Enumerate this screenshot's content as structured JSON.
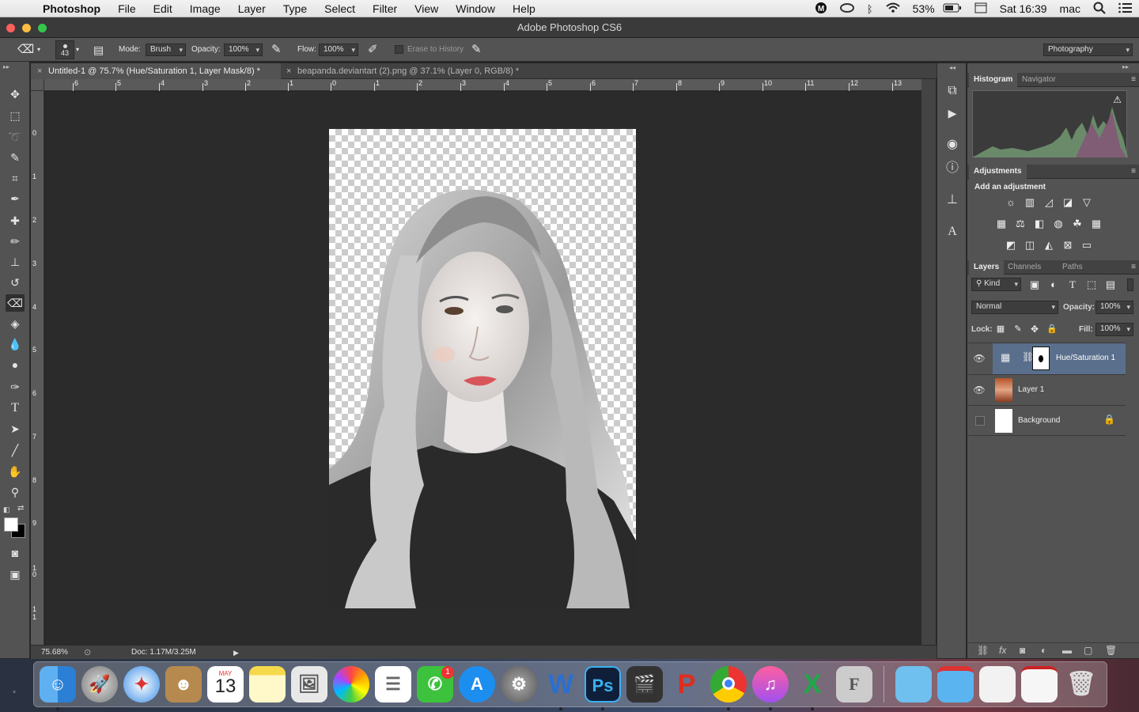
{
  "menubar": {
    "app_name": "Photoshop",
    "items": [
      "File",
      "Edit",
      "Image",
      "Layer",
      "Type",
      "Select",
      "Filter",
      "View",
      "Window",
      "Help"
    ],
    "battery": "53%",
    "clock": "Sat 16:39",
    "user": "mac"
  },
  "window": {
    "title": "Adobe Photoshop CS6"
  },
  "options": {
    "brush_size": "43",
    "mode_label": "Mode:",
    "mode_value": "Brush",
    "opacity_label": "Opacity:",
    "opacity_value": "100%",
    "flow_label": "Flow:",
    "flow_value": "100%",
    "erase_history": "Erase to History",
    "workspace": "Photography"
  },
  "tabs": [
    {
      "label": "Untitled-1 @ 75.7% (Hue/Saturation 1, Layer Mask/8) *"
    },
    {
      "label": "beapanda.deviantart (2).png @ 37.1% (Layer 0, RGB/8) *"
    }
  ],
  "ruler": {
    "h": [
      "6",
      "5",
      "4",
      "3",
      "2",
      "1",
      "0",
      "1",
      "2",
      "3",
      "4",
      "5",
      "6",
      "7",
      "8",
      "9",
      "10",
      "11",
      "12",
      "13"
    ],
    "v": [
      "0",
      "1",
      "2",
      "3",
      "4",
      "5",
      "6",
      "7",
      "8",
      "9",
      "1",
      "0",
      "1",
      "1"
    ]
  },
  "status": {
    "zoom": "75.68%",
    "doc": "Doc: 1.17M/3.25M"
  },
  "panels": {
    "histogram_tabs": [
      "Histogram",
      "Navigator"
    ],
    "adjustments_tab": "Adjustments",
    "adjustments_title": "Add an adjustment",
    "layers_tabs": [
      "Layers",
      "Channels",
      "Paths"
    ],
    "kind": "Kind",
    "blend_mode": "Normal",
    "opacity_label": "Opacity:",
    "opacity_value": "100%",
    "lock_label": "Lock:",
    "fill_label": "Fill:",
    "fill_value": "100%",
    "layers": [
      {
        "name": "Hue/Saturation 1"
      },
      {
        "name": "Layer 1"
      },
      {
        "name": "Background"
      }
    ]
  },
  "dock": {
    "calendar_month": "MAY",
    "calendar_day": "13",
    "facetime_badge": "1",
    "apps": [
      "finder",
      "launchpad",
      "safari",
      "contacts",
      "calendar",
      "notes",
      "preview",
      "photos",
      "reminders",
      "facetime",
      "app-store",
      "system-preferences",
      "word",
      "photoshop",
      "final-cut",
      "powerpoint",
      "chrome",
      "itunes",
      "excel",
      "font-book",
      "folder",
      "folder-red",
      "screenshot",
      "screenshot2",
      "trash"
    ]
  }
}
